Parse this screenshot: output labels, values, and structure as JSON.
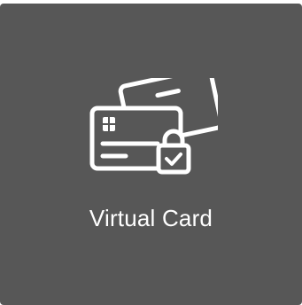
{
  "tile": {
    "label": "Virtual Card",
    "icon": "virtual-card-lock-icon",
    "colors": {
      "background": "#575757",
      "foreground": "#ffffff"
    }
  }
}
